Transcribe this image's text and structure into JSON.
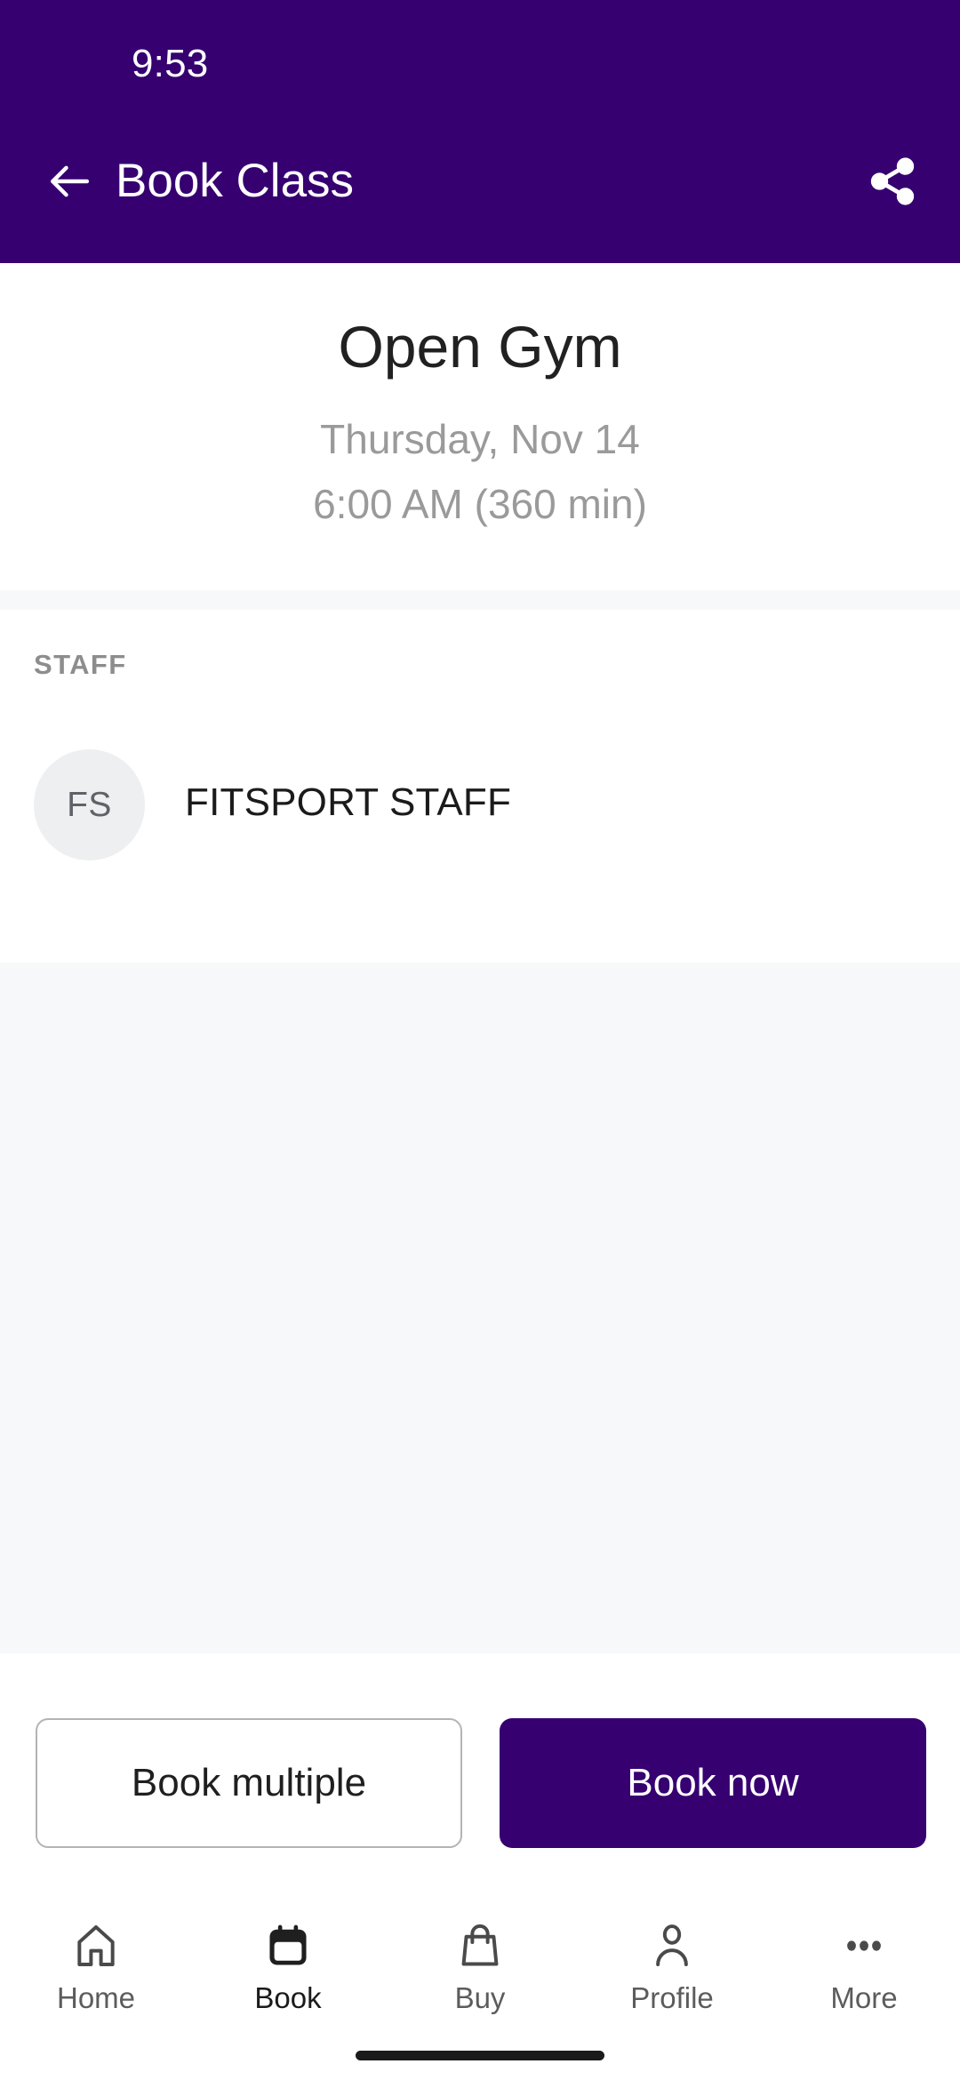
{
  "status_bar": {
    "time": "9:53",
    "background_color": "#360070"
  },
  "app_bar": {
    "title": "Book Class",
    "back_icon": "arrow-left-icon",
    "share_icon": "share-icon",
    "background_color": "#360070",
    "text_color": "#FFFFFF"
  },
  "class": {
    "name": "Open Gym",
    "date": "Thursday, Nov 14",
    "time": "6:00 AM (360 min)"
  },
  "staff_section": {
    "header": "STAFF",
    "members": [
      {
        "initials": "FS",
        "name": "FITSPORT STAFF"
      }
    ]
  },
  "actions": {
    "secondary_label": "Book multiple",
    "primary_label": "Book now",
    "primary_color": "#360070"
  },
  "bottom_nav": {
    "items": [
      {
        "label": "Home",
        "icon": "home-icon",
        "active": false
      },
      {
        "label": "Book",
        "icon": "calendar-icon",
        "active": true
      },
      {
        "label": "Buy",
        "icon": "shopping-bag-icon",
        "active": false
      },
      {
        "label": "Profile",
        "icon": "person-icon",
        "active": false
      },
      {
        "label": "More",
        "icon": "more-horizontal-icon",
        "active": false
      }
    ]
  }
}
